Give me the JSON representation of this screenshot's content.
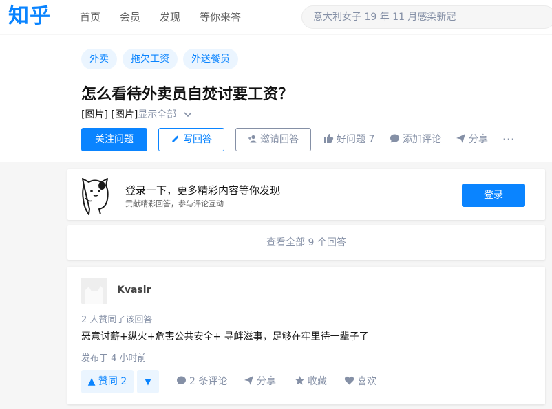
{
  "header": {
    "logo": "知乎",
    "nav": [
      "首页",
      "会员",
      "发现",
      "等你来答"
    ],
    "search_placeholder": "意大利女子 19 年 11 月感染新冠"
  },
  "question": {
    "tags": [
      "外卖",
      "拖欠工资",
      "外送餐员"
    ],
    "title": "怎么看待外卖员自焚讨要工资？",
    "detail": "[图片] [图片]",
    "show_all": "显示全部",
    "follow_label": "关注问题",
    "write_label": "写回答",
    "invite_label": "邀请回答",
    "good_question_label": "好问题 7",
    "comment_label": "添加评论",
    "share_label": "分享",
    "more_label": "···"
  },
  "login_prompt": {
    "title": "登录一下，更多精彩内容等你发现",
    "subtitle": "贡献精彩回答，参与评论互动",
    "button": "登录"
  },
  "view_all": "查看全部 9 个回答",
  "answer": {
    "author": "Kvasir",
    "agree_info": "2 人赞同了该回答",
    "content": "恶意讨薪+纵火+危害公共安全+ 寻衅滋事，足够在牢里待一辈子了",
    "time": "发布于 4 小时前",
    "vote_up_label": "▲ 赞同 2",
    "vote_down_label": "▼",
    "comments_label": "2 条评论",
    "share_label": "分享",
    "collect_label": "收藏",
    "like_label": "喜欢"
  },
  "colors": {
    "brand": "#0a84ff",
    "muted": "#8590a6",
    "tag_bg": "#ebf5ff",
    "page_bg": "#f6f6f6"
  },
  "icons": [
    "pen-icon",
    "invite-icon",
    "thumb-up-icon",
    "comment-icon",
    "share-icon",
    "star-icon",
    "heart-icon",
    "chevron-down-icon"
  ]
}
